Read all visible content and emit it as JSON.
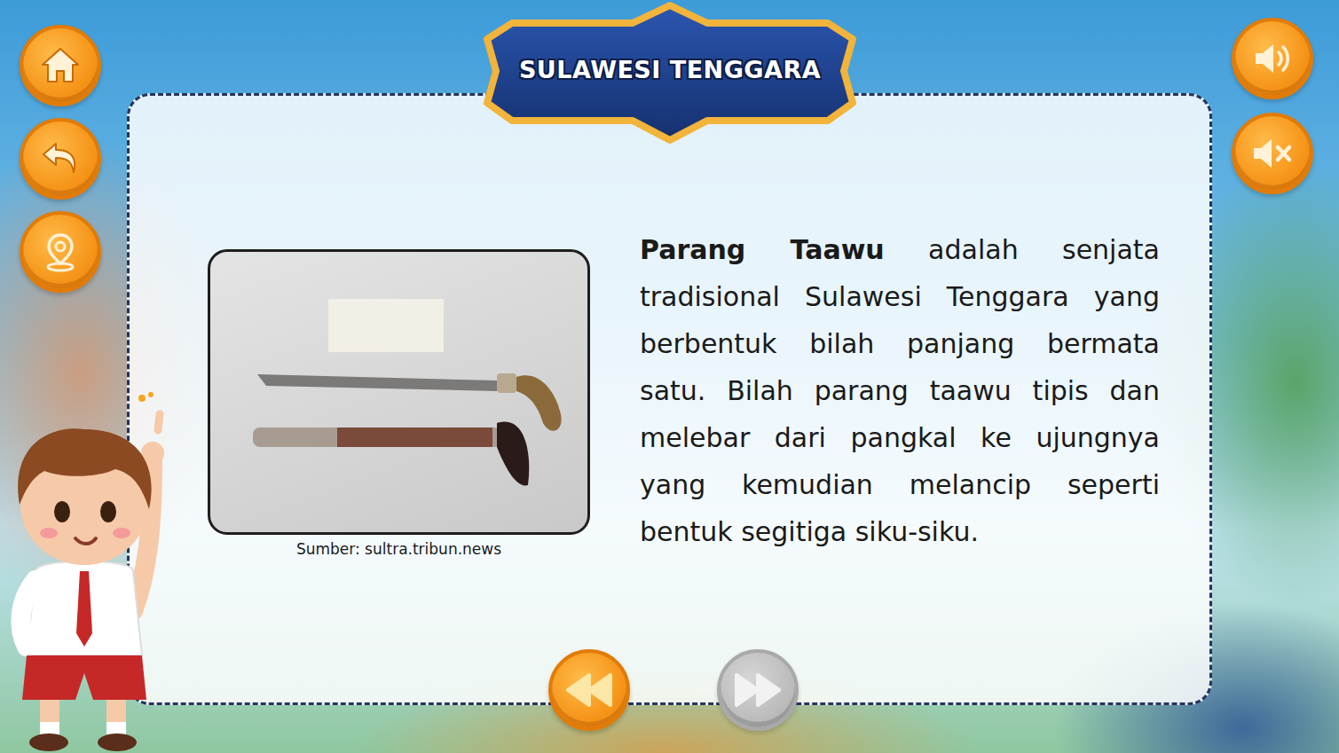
{
  "title": "SULAWESI TENGGARA",
  "article": {
    "term": "Parang Taawu",
    "body": "adalah senjata tradisional Sulawesi Tenggara yang berbentuk bilah panjang bermata satu. Bilah parang taawu tipis dan melebar dari pangkal ke ujungnya yang kemudian melancip seperti bentuk segitiga siku-siku."
  },
  "image": {
    "caption": "Sumber: sultra.tribun.news"
  },
  "pager": [
    {
      "kind": "previous",
      "disabled": false
    },
    {
      "kind": "next",
      "disabled": true
    }
  ]
}
